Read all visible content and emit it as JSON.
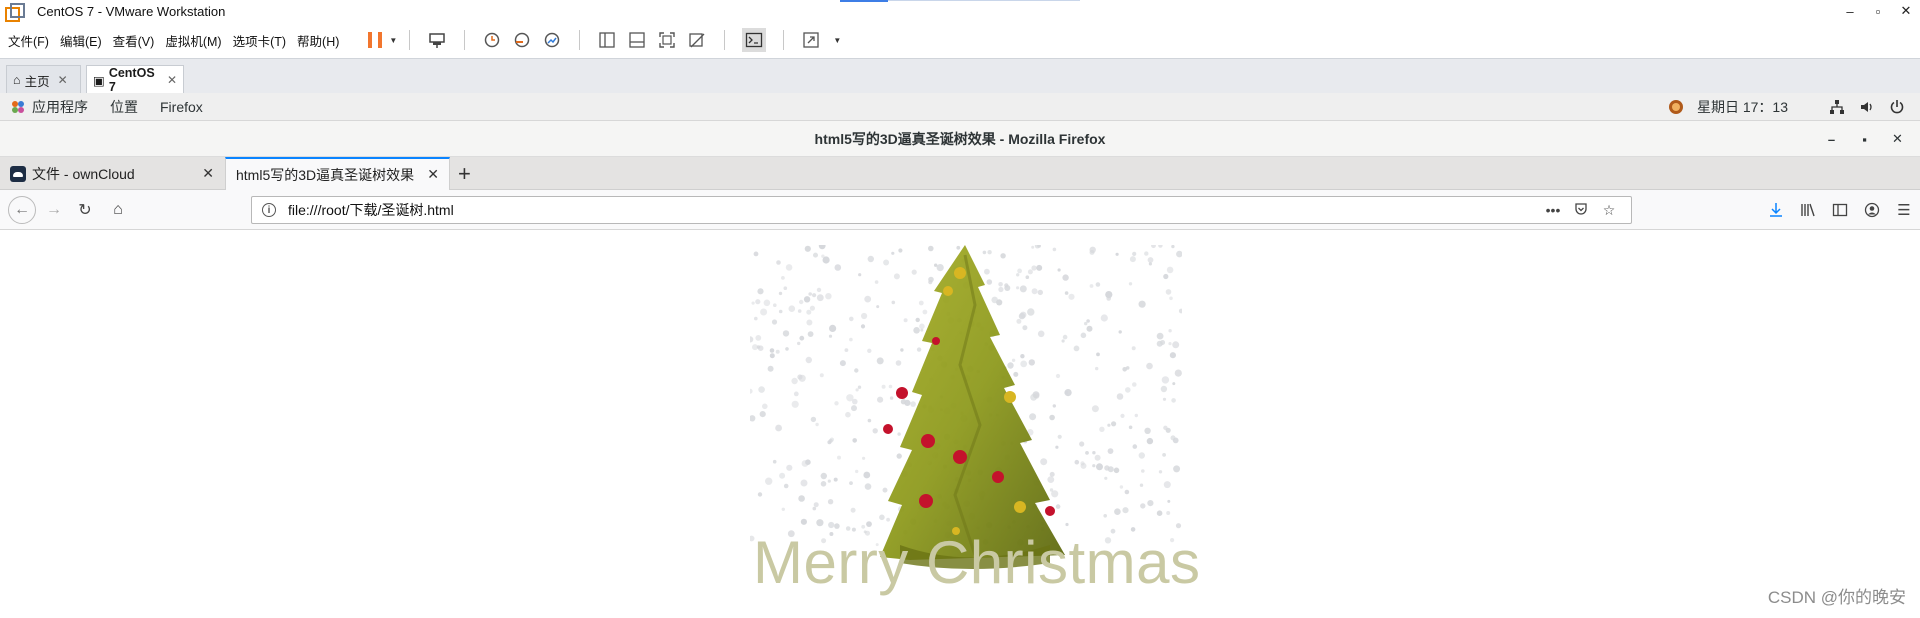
{
  "vmware": {
    "title": "CentOS 7 - VMware Workstation",
    "menu": [
      "文件(F)",
      "编辑(E)",
      "查看(V)",
      "虚拟机(M)",
      "选项卡(T)",
      "帮助(H)"
    ],
    "tabs": [
      {
        "label": "主页",
        "icon": "home-icon"
      },
      {
        "label": "CentOS 7",
        "icon": "vm-icon"
      }
    ]
  },
  "gnome": {
    "items": [
      "应用程序",
      "位置",
      "Firefox"
    ],
    "clock": "星期日 17：13"
  },
  "firefox": {
    "window_title": "html5写的3D逼真圣诞树效果  -  Mozilla Firefox",
    "tabs": [
      {
        "label": "文件 - ownCloud"
      },
      {
        "label": "html5写的3D逼真圣诞树效果"
      }
    ],
    "url": "file:///root/下载/圣诞树.html"
  },
  "page": {
    "greeting": "Merry Christmas",
    "watermark": "CSDN @你的晚安"
  },
  "colors": {
    "tree": "#8e9a1e",
    "ornament_red": "#c4122c",
    "ornament_gold": "#d8b622",
    "greeting": "#c9c9a3",
    "tab_accent": "#0a84ff"
  }
}
